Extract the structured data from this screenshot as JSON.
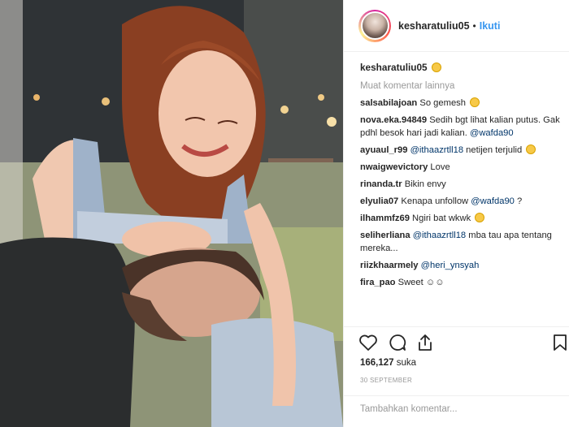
{
  "post": {
    "username": "kesharatuliu05",
    "separator": "•",
    "follow_label": "Ikuti",
    "caption_user": "kesharatuliu05",
    "load_more": "Muat komentar lainnya"
  },
  "comments": [
    {
      "user": "salsabilajoan",
      "text": "So gemesh",
      "mention": "",
      "text_after": "",
      "emoji": true
    },
    {
      "user": "nova.eka.94849",
      "text": "Sedih bgt lihat kalian putus. Gak pdhl besok hari jadi kalian.",
      "mention": "@wafda90",
      "text_after": "",
      "emoji": false
    },
    {
      "user": "ayuaul_r99",
      "text": "",
      "mention": "@ithaazrtll18",
      "text_after": "netijen terjulid",
      "emoji": true
    },
    {
      "user": "nwaigwevictory",
      "text": "Love",
      "mention": "",
      "text_after": "",
      "emoji": false
    },
    {
      "user": "rinanda.tr",
      "text": "Bikin envy",
      "mention": "",
      "text_after": "",
      "emoji": false
    },
    {
      "user": "elyulia07",
      "text": "Kenapa unfollow",
      "mention": "@wafda90",
      "text_after": "?",
      "emoji": false
    },
    {
      "user": "ilhammfz69",
      "text": "Ngiri bat wkwk",
      "mention": "",
      "text_after": "",
      "emoji": true
    },
    {
      "user": "seliherliana",
      "text": "",
      "mention": "@ithaazrtll18",
      "text_after": "mba tau apa tentang mereka...",
      "emoji": false
    },
    {
      "user": "riizkhaarmely",
      "text": "",
      "mention": "@heri_ynsyah",
      "text_after": "",
      "emoji": false
    },
    {
      "user": "fira_pao",
      "text": "Sweet ☺☺",
      "mention": "",
      "text_after": "",
      "emoji": false
    }
  ],
  "actions": {
    "likes_count": "166,127",
    "likes_label": "suka",
    "date": "30 SEPTEMBER",
    "comment_placeholder": "Tambahkan komentar..."
  },
  "icons": [
    "heart-icon",
    "comment-icon",
    "share-icon",
    "bookmark-icon"
  ],
  "colors": {
    "link": "#3897f0",
    "mention": "#003569",
    "muted": "#999999"
  }
}
